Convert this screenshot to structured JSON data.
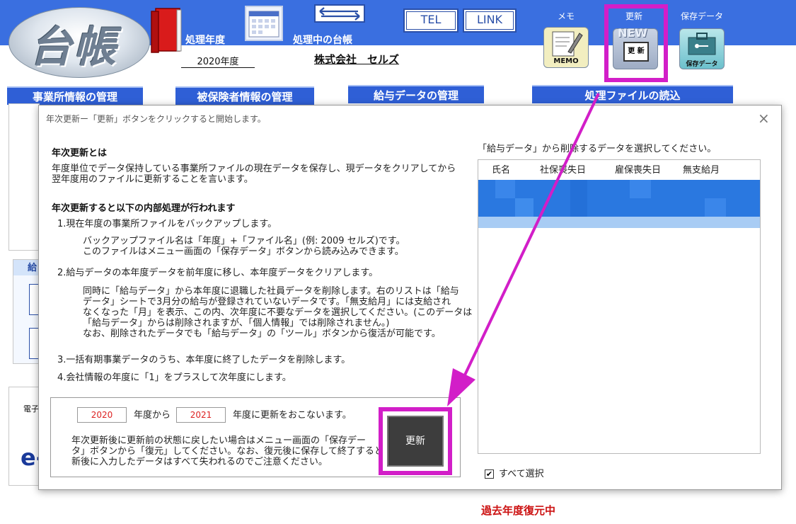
{
  "app": {
    "logo_text": "台帳",
    "fiscal_year_label": "処理年度",
    "fiscal_year_value": "2020年度",
    "current_ledger_label": "処理中の台帳",
    "company_name": "株式会社　セルズ",
    "tel_label": "TEL",
    "link_label": "LINK"
  },
  "top_icons": [
    {
      "label": "メモ",
      "icon_text": "MEMO"
    },
    {
      "label": "更新",
      "icon_text": "更 新",
      "badge": "NEW"
    },
    {
      "label": "保存データ",
      "icon_text": "保存データ"
    }
  ],
  "tabs": [
    "事業所情報の管理",
    "被保険者情報の管理",
    "給与データの管理",
    "処理ファイルの読込"
  ],
  "bg_left_fragments": [
    "給",
    "電子",
    "e-"
  ],
  "dialog": {
    "title": "年次更新ー「更新」ボタンをクリックすると開始します。",
    "close": "×",
    "section1_title": "年次更新とは",
    "section1_body": [
      "年度単位でデータ保持している事業所ファイルの現在データを保存し、現データをクリアしてから",
      "翌年度用のファイルに更新することを言います。"
    ],
    "section2_title": "年次更新すると以下の内部処理が行われます",
    "step1": "1.現在年度の事業所ファイルをバックアップします。",
    "step1_detail": [
      "バックアップファイル名は「年度」+「ファイル名」(例: 2009 セルズ)です。",
      "このファイルはメニュー画面の「保存データ」ボタンから読み込みできます。"
    ],
    "step2": "2.給与データの本年度データを前年度に移し、本年度データをクリアします。",
    "step2_detail": [
      "同時に「給与データ」から本年度に退職した社員データを削除します。右のリストは「給与",
      "データ」シートで3月分の給与が登録されていないデータです。「無支給月」には支給され",
      "なくなった「月」を表示、この内、次年度に不要なデータを選択してください。(このデータは",
      "「給与データ」からは削除されますが、「個人情報」では削除されません。)",
      "なお、削除されたデータでも「給与データ」の「ツール」ボタンから復活が可能です。"
    ],
    "step3": "3.一括有期事業データのうち、本年度に終了したデータを削除します。",
    "step4": "4.会社情報の年度に「1」をプラスして次年度にします。",
    "from_year": "2020",
    "from_label": "年度から",
    "to_year": "2021",
    "to_label": "年度に更新をおこないます。",
    "note": [
      "年次更新後に更新前の状態に戻したい場合はメニュー画面の「保存デー",
      "タ」ボタンから「復元」してください。なお、復元後に保存して終了すると、更",
      "新後に入力したデータはすべて失われるのでご注意ください。"
    ],
    "update_button": "更新",
    "list_instruction": "「給与データ」から削除するデータを選択してください。",
    "list_columns": [
      "氏名",
      "社保喪失日",
      "雇保喪失日",
      "無支給月"
    ],
    "select_all_label": "すべて選択",
    "select_all_checked": true
  },
  "status_text": "過去年度復元中",
  "colors": {
    "banner": "#3a6fe0",
    "tab": "#2f5fd6",
    "highlight": "#d21ec8",
    "status_red": "#cc1111",
    "selected_row": "#2a78e0"
  }
}
